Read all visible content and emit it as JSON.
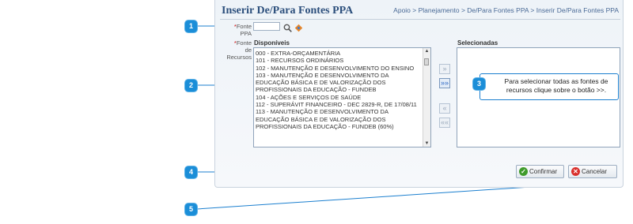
{
  "page": {
    "title": "Inserir De/Para Fontes PPA",
    "breadcrumb": "Apoio > Planejamento > De/Para Fontes PPA > Inserir De/Para Fontes PPA"
  },
  "form": {
    "required_mark": "*",
    "fonte_label_line1": "Fonte",
    "fonte_label_line2": "PPA",
    "fonte_value": "",
    "fonte_recursos_line1": "Fonte",
    "fonte_recursos_line2": "de",
    "fonte_recursos_line3": "Recursos"
  },
  "shuttle": {
    "available_header": "Disponíveis",
    "selected_header": "Selecionadas",
    "available_items": [
      "000 - EXTRA-ORÇAMENTÁRIA",
      "101 - RECURSOS ORDINÁRIOS",
      "102 - MANUTENÇÃO E DESENVOLVIMENTO DO ENSINO",
      "103 - MANUTENÇÃO E DESENVOLVIMENTO DA EDUCAÇÃO BÁSICA E DE VALORIZAÇÃO DOS PROFISSIONAIS DA EDUCAÇÃO - FUNDEB",
      "104 - AÇÕES E SERVIÇOS DE SAÚDE",
      "112 - SUPERÁVIT FINANCEIRO - DEC 2829-R, DE 17/08/11",
      "113 - MANUTENÇÃO E DESENVOLVIMENTO DA EDUCAÇÃO BÁSICA E DE VALORIZAÇÃO DOS PROFISSIONAIS DA EDUCAÇÃO - FUNDEB (60%)"
    ],
    "selected_items": [],
    "move_one": "»",
    "move_all": "»»",
    "remove_one": "«",
    "remove_all": "««"
  },
  "buttons": {
    "confirm": "Confirmar",
    "cancel": "Cancelar"
  },
  "callouts": {
    "c1": "1",
    "c2": "2",
    "c3": "3",
    "c4": "4",
    "c5": "5",
    "tooltip_3": "Para selecionar todas as fontes de recursos clique sobre o botão >>."
  },
  "icons": {
    "search": "search-icon",
    "clear": "clear-icon",
    "confirm": "check-icon",
    "cancel": "x-icon"
  },
  "colors": {
    "callout": "#1b8ed8",
    "title": "#2c4f7c",
    "confirm_icon": "#3f9b2b",
    "cancel_icon": "#d9302c"
  }
}
